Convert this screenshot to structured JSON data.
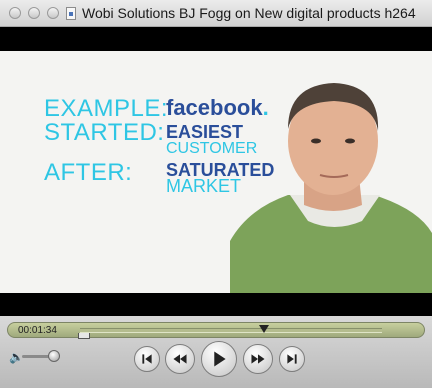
{
  "window": {
    "title": "Wobi Solutions BJ Fogg on New digital products h264"
  },
  "video": {
    "rows": [
      {
        "label": "EXAMPLE:",
        "value": "facebook",
        "value_suffix": "."
      },
      {
        "label": "STARTED:",
        "value": "EASIEST",
        "value_line2": "CUSTOMER"
      },
      {
        "label": "AFTER:",
        "value": "SATURATED",
        "value_line2": "MARKET"
      }
    ],
    "colors": {
      "label": "#2ec6e4",
      "value": "#2a4e9a"
    }
  },
  "controls": {
    "current_time": "00:01:34",
    "playback_progress": 0.61,
    "volume_level": 0.85,
    "buttons": [
      {
        "name": "skip-to-start",
        "icon": "skip-back-icon"
      },
      {
        "name": "rewind",
        "icon": "rewind-icon"
      },
      {
        "name": "play",
        "icon": "play-icon"
      },
      {
        "name": "fast-forward",
        "icon": "fast-forward-icon"
      },
      {
        "name": "skip-to-end",
        "icon": "skip-forward-icon"
      }
    ]
  }
}
